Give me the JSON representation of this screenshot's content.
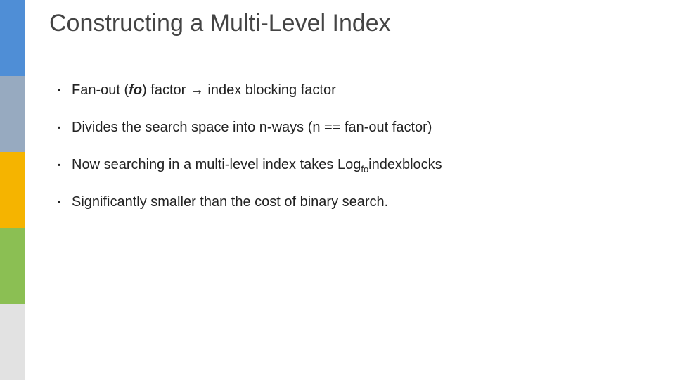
{
  "title": "Constructing a Multi-Level Index",
  "bullets": {
    "b0": {
      "pre": "Fan-out (",
      "fo": "fo",
      "post_fo": ") factor ",
      "arrow": "→",
      "after": " index blocking factor"
    },
    "b1": "Divides the search space into n-ways (n == fan-out factor)",
    "b2": {
      "pre": "Now searching in a multi-level index takes Log",
      "sub": "fo",
      "after": "indexblocks"
    },
    "b3": "Significantly smaller than the cost of binary search."
  },
  "marker": "▪"
}
